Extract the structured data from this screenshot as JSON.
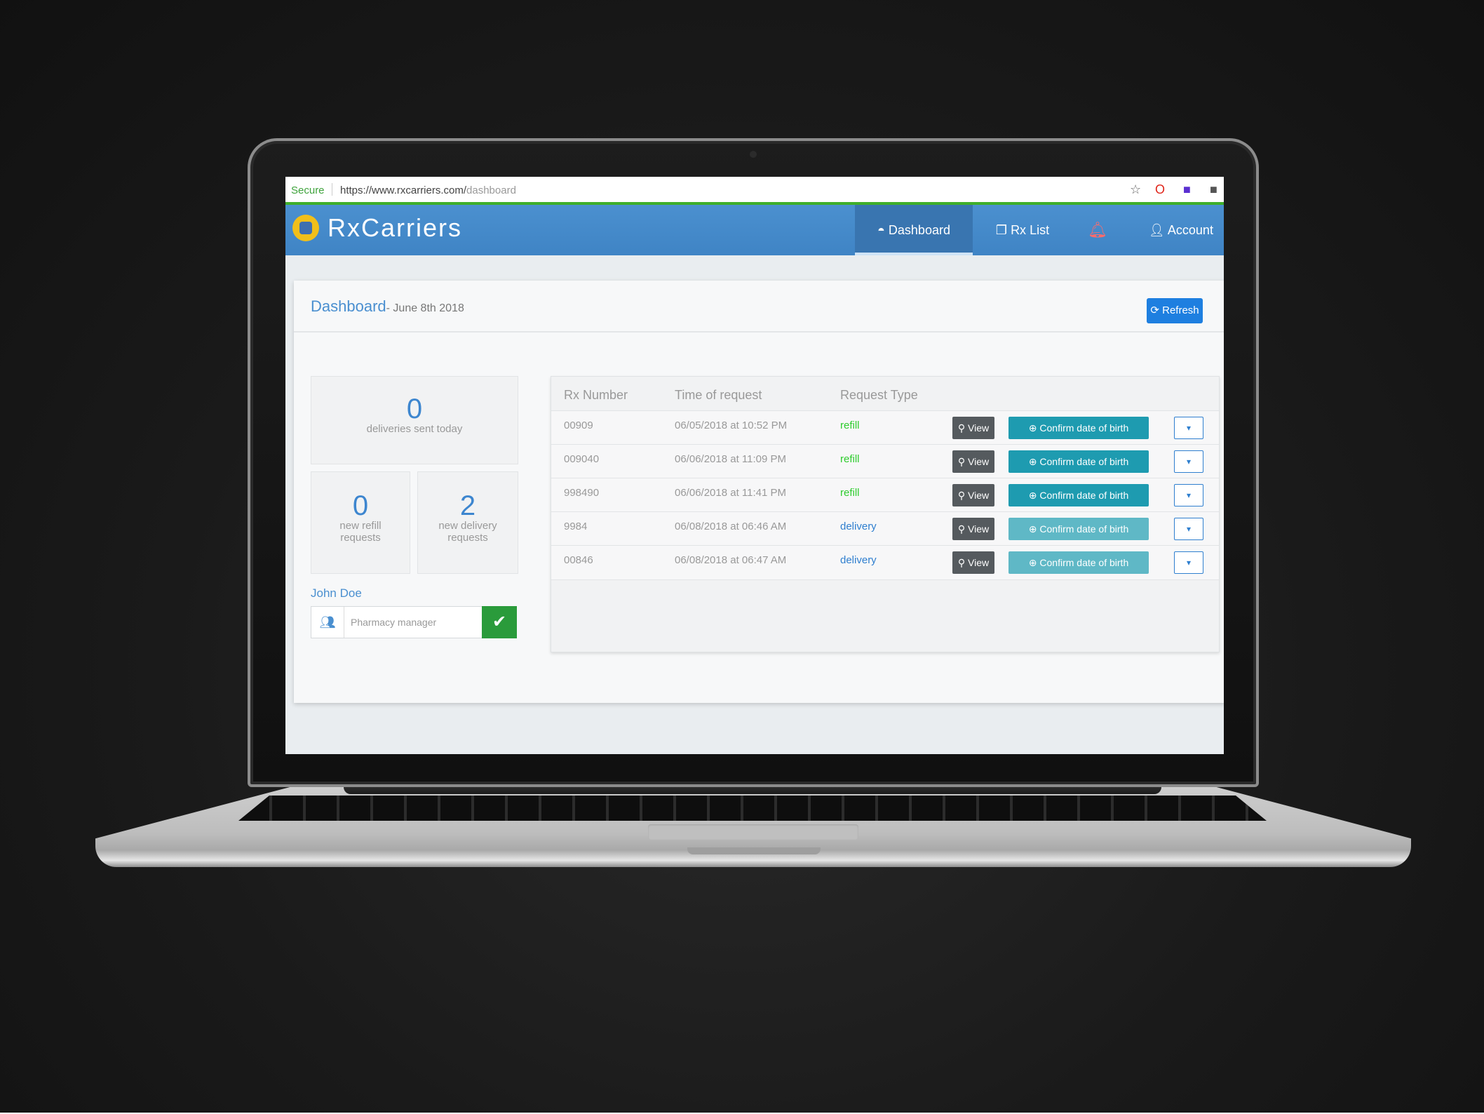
{
  "browser": {
    "secure_label": "Secure",
    "url_main": "https://www.rxcarriers.com/",
    "url_path": "dashboard"
  },
  "navbar": {
    "brand": "RxCarriers",
    "dashboard_label": "Dashboard",
    "rxlist_label": "Rx List",
    "account_label": "Account"
  },
  "header": {
    "title": "Dashboard",
    "date": "- June 8th 2018",
    "refresh_label": "Refresh"
  },
  "stats": {
    "deliveries_count": "0",
    "deliveries_label": "deliveries sent today",
    "refill_count": "0",
    "refill_label": "new refill requests",
    "delivery_count": "2",
    "delivery_label": "new delivery requests"
  },
  "user": {
    "name": "John Doe",
    "role": "Pharmacy manager"
  },
  "table": {
    "headers": [
      "Rx Number",
      "Time of request",
      "Request Type"
    ],
    "view_label": "View",
    "confirm_label": "Confirm date of birth",
    "rows": [
      {
        "rx": "00909",
        "time": "06/05/2018 at 10:52 PM",
        "type": "refill"
      },
      {
        "rx": "009040",
        "time": "06/06/2018 at 11:09 PM",
        "type": "refill"
      },
      {
        "rx": "998490",
        "time": "06/06/2018 at 11:41 PM",
        "type": "refill"
      },
      {
        "rx": "9984",
        "time": "06/08/2018 at 06:46 AM",
        "type": "delivery"
      },
      {
        "rx": "00846",
        "time": "06/08/2018 at 06:47 AM",
        "type": "delivery"
      }
    ]
  },
  "colors": {
    "brand_blue": "#4b90cf",
    "refill_green": "#2ecc2e",
    "delivery_blue": "#2f7fcf",
    "confirm_teal": "#1e9bb0"
  }
}
